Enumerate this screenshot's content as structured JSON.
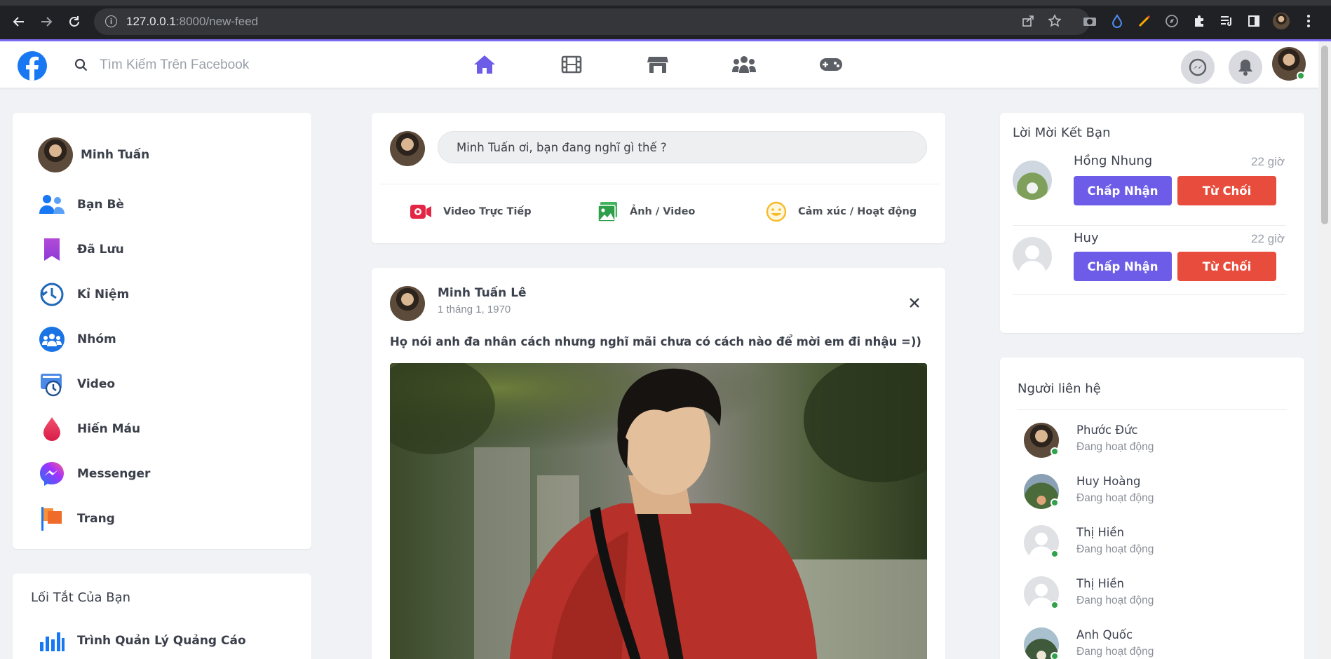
{
  "browser": {
    "url_host": "127.0.0.1",
    "url_path": ":8000/new-feed"
  },
  "header": {
    "search_placeholder": "Tìm Kiếm Trên Facebook",
    "accent_color": "#6c5ce7"
  },
  "left_menu": {
    "items": [
      {
        "label": "Minh Tuấn",
        "icon": "user-avatar"
      },
      {
        "label": "Bạn Bè",
        "icon": "friends-icon"
      },
      {
        "label": "Đã Lưu",
        "icon": "bookmark-icon"
      },
      {
        "label": "Kỉ Niệm",
        "icon": "memories-clock-icon"
      },
      {
        "label": "Nhóm",
        "icon": "groups-icon"
      },
      {
        "label": "Video",
        "icon": "video-icon"
      },
      {
        "label": "Hiến Máu",
        "icon": "blood-drop-icon"
      },
      {
        "label": "Messenger",
        "icon": "messenger-icon"
      },
      {
        "label": "Trang",
        "icon": "flag-icon"
      }
    ]
  },
  "shortcuts": {
    "title": "Lối Tắt Của Bạn",
    "items": [
      {
        "label": "Trình Quản Lý Quảng Cáo",
        "icon": "ads-chart-icon"
      }
    ]
  },
  "composer": {
    "prompt": "Minh Tuấn ơi, bạn đang nghĩ gì thế ?",
    "actions": [
      {
        "label": "Video Trực Tiếp",
        "icon": "live-video-icon"
      },
      {
        "label": "Ảnh / Video",
        "icon": "photo-icon"
      },
      {
        "label": "Cảm xúc / Hoạt động",
        "icon": "smile-icon"
      }
    ]
  },
  "post": {
    "author": "Minh Tuấn Lê",
    "date": "1 tháng 1, 1970",
    "text": "Họ nói anh đa nhân cách nhưng nghĩ mãi chưa có cách nào để mời em đi nhậu =))"
  },
  "friend_requests": {
    "title": "Lời Mời Kết Bạn",
    "accept_label": "Chấp Nhận",
    "reject_label": "Từ Chối",
    "items": [
      {
        "name": "Hồng Nhung",
        "time": "22 giờ"
      },
      {
        "name": "Huy",
        "time": "22 giờ"
      }
    ]
  },
  "contacts": {
    "title": "Người liên hệ",
    "items": [
      {
        "name": "Phước Đức",
        "status": "Đang hoạt động"
      },
      {
        "name": "Huy Hoàng",
        "status": "Đang hoạt động"
      },
      {
        "name": "Thị Hiền",
        "status": "Đang hoạt động"
      },
      {
        "name": "Thị Hiền",
        "status": "Đang hoạt động"
      },
      {
        "name": "Anh Quốc",
        "status": "Đang hoạt động"
      }
    ]
  }
}
